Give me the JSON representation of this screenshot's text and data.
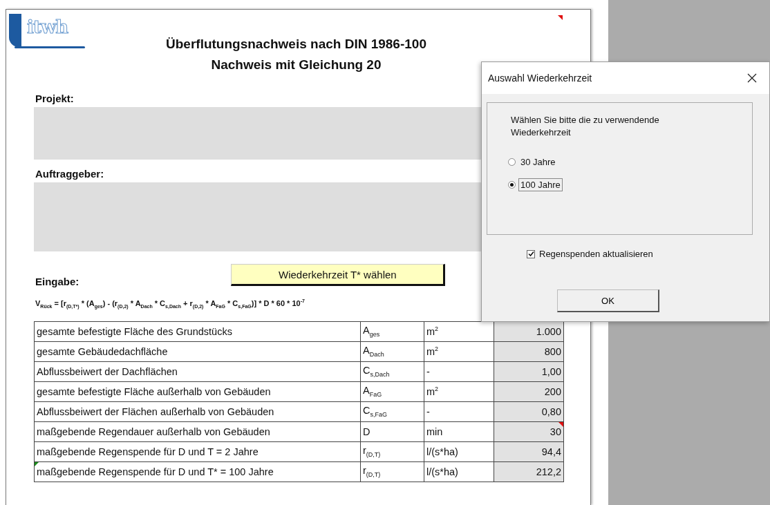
{
  "sheet": {
    "logo": {
      "text": "itwh"
    },
    "title": [
      "Überflutungsnachweis nach DIN 1986-100",
      "Nachweis mit Gleichung 20"
    ],
    "title_comment": true,
    "sections": [
      {
        "label": "Projekt:"
      },
      {
        "label": "Auftraggeber:"
      }
    ],
    "input_label": "Eingabe:",
    "action_button": "Wiederkehrzeit T* wählen",
    "formula": [
      {
        "kind": "text",
        "t": "V"
      },
      {
        "kind": "sub",
        "t": "Rück"
      },
      {
        "kind": "text",
        "t": " = [r"
      },
      {
        "kind": "sub",
        "t": "(D,T*)"
      },
      {
        "kind": "text",
        "t": " * (A"
      },
      {
        "kind": "sub",
        "t": "ges"
      },
      {
        "kind": "text",
        "t": ") -  (r"
      },
      {
        "kind": "sub",
        "t": "(D,2)"
      },
      {
        "kind": "text",
        "t": " * A"
      },
      {
        "kind": "sub",
        "t": "Dach"
      },
      {
        "kind": "text",
        "t": " * C"
      },
      {
        "kind": "sub",
        "t": "s,Dach"
      },
      {
        "kind": "text",
        "t": " + r"
      },
      {
        "kind": "sub",
        "t": "(D,2)"
      },
      {
        "kind": "text",
        "t": " * A"
      },
      {
        "kind": "sub",
        "t": "FaG"
      },
      {
        "kind": "text",
        "t": " * C"
      },
      {
        "kind": "sub",
        "t": "s,FaG"
      },
      {
        "kind": "text",
        "t": ")] * D * 60 * 10"
      },
      {
        "kind": "sup",
        "t": "-7"
      }
    ],
    "table": {
      "rows": [
        {
          "label": "gesamte befestigte Fläche des Grundstücks",
          "symbol": "A$_{ges}$",
          "unit": "m$^{2}$",
          "value": "1.000",
          "value_comment": false,
          "label_flag": false
        },
        {
          "label": "gesamte Gebäudedachfläche",
          "symbol": "A$_{Dach}$",
          "unit": "m$^{2}$",
          "value": "800",
          "value_comment": false,
          "label_flag": false
        },
        {
          "label": "Abflussbeiwert der Dachflächen",
          "symbol": "C$_{s,Dach}$",
          "unit": "-",
          "value": "1,00",
          "value_comment": false,
          "label_flag": false
        },
        {
          "label": "gesamte befestigte Fläche außerhalb von Gebäuden",
          "symbol": "A$_{FaG}$",
          "unit": "m$^{2}$",
          "value": "200",
          "value_comment": false,
          "label_flag": false
        },
        {
          "label": "Abflussbeiwert der Flächen außerhalb von Gebäuden",
          "symbol": "C$_{s,FaG}$",
          "unit": "-",
          "value": "0,80",
          "value_comment": false,
          "label_flag": false
        },
        {
          "label": "maßgebende Regendauer außerhalb von Gebäuden",
          "symbol": "D",
          "unit": "min",
          "value": "30",
          "value_comment": true,
          "label_flag": false
        },
        {
          "label": "maßgebende Regenspende für D und T = 2 Jahre",
          "symbol": "r$_{(D,T)}$",
          "unit": "l/(s*ha)",
          "value": "94,4",
          "value_comment": false,
          "label_flag": false
        },
        {
          "label": "maßgebende Regenspende für D und T* = 100 Jahre",
          "symbol": "r$_{(D,T)}$",
          "unit": "l/(s*ha)",
          "value": "212,2",
          "value_comment": false,
          "label_flag": true
        }
      ]
    }
  },
  "dialog": {
    "title": "Auswahl Wiederkehrzeit",
    "prompt": "Wählen Sie bitte die zu verwendende Wiederkehrzeit",
    "options": [
      {
        "label": "30 Jahre",
        "selected": false
      },
      {
        "label": "100 Jahre",
        "selected": true
      }
    ],
    "checkbox": {
      "label": "Regenspenden aktualisieren",
      "checked": true
    },
    "button": "OK"
  }
}
